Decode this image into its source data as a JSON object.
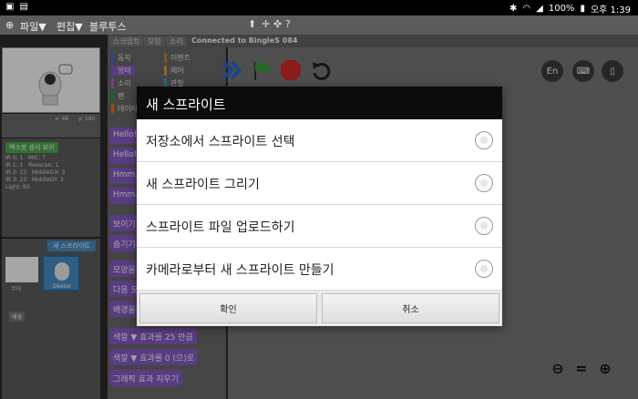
{
  "status_bar": {
    "battery": "100%",
    "time": "오후 1:39"
  },
  "menu": {
    "file": "파일▼",
    "edit": "편집▼",
    "bluetooth": "블루투스"
  },
  "tabs": [
    "스크립트",
    "모양",
    "소리"
  ],
  "connection": "Connected to BingleS 084",
  "stage": {
    "x_label": "x: 48",
    "y_label": "y: 180"
  },
  "sensor": {
    "title": "벡스봇 센서 뷰어",
    "rows": [
      [
        "IR 0:",
        "1",
        "MIC:",
        "7"
      ],
      [
        "IR 1:",
        "1",
        "Reoscan:",
        "1"
      ],
      [
        "IR 2:",
        "23",
        "MobileGX:",
        "3"
      ],
      [
        "IR 3:",
        "23",
        "MobileGY:",
        "3"
      ],
      [
        "Light:",
        "60",
        "",
        ""
      ]
    ]
  },
  "sprites": {
    "new_sprite": "새 스프라이트",
    "stage_label": "무대",
    "backdrop": "배경",
    "sprite_name": "Dexter"
  },
  "categories": [
    "동작",
    "형태",
    "소리",
    "펜",
    "데이터",
    "이벤트",
    "제어",
    "관찰",
    "연산자",
    "추가 블록"
  ],
  "blocks": [
    "Hello!",
    "Hello!",
    "Hmm...",
    "Hmm...",
    "보이기",
    "숨기기",
    "모양을",
    "다음 모양",
    "배경을",
    "색깔 ▼ 효과를 25 만큼",
    "색깔 ▼ 효과를 0 (으)로",
    "그래픽 효과 지우기"
  ],
  "toolbar": {
    "lang": "En"
  },
  "dialog": {
    "title": "새 스프라이트",
    "options": [
      "저장소에서 스프라이트 선택",
      "새 스프라이트 그리기",
      "스프라이트 파일 업로드하기",
      "카메라로부터 새 스프라이트 만들기"
    ],
    "ok": "확인",
    "cancel": "취소"
  }
}
